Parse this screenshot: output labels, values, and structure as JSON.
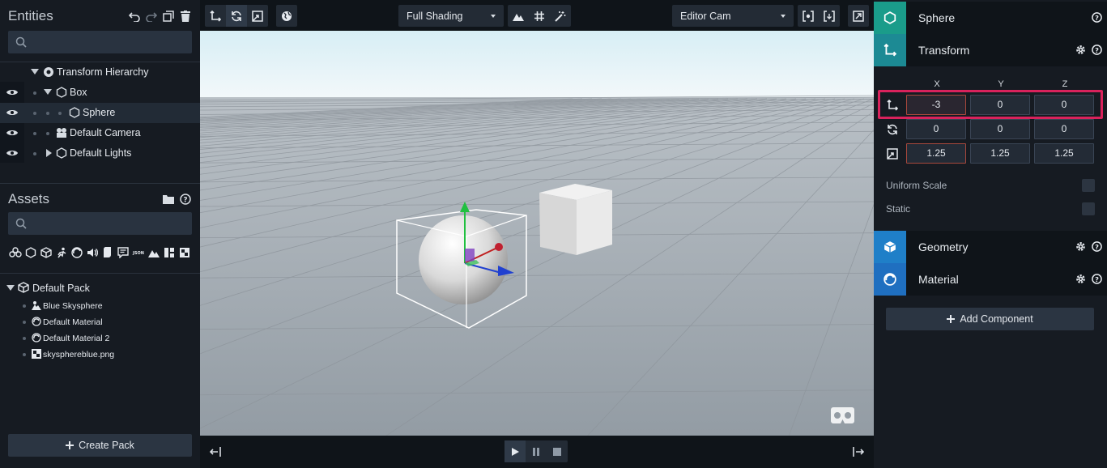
{
  "entities": {
    "title": "Entities",
    "search_placeholder": "",
    "tree": [
      {
        "label": "Transform Hierarchy",
        "icon": "hierarchy-icon"
      },
      {
        "label": "Box",
        "icon": "hexagon-icon"
      },
      {
        "label": "Sphere",
        "icon": "hexagon-icon"
      },
      {
        "label": "Default Camera",
        "icon": "camera-icon"
      },
      {
        "label": "Default Lights",
        "icon": "hexagon-icon"
      }
    ]
  },
  "assets": {
    "title": "Assets",
    "search_placeholder": "",
    "pack": {
      "label": "Default Pack"
    },
    "items": [
      {
        "label": "Blue Skysphere",
        "icon": "skysphere-icon"
      },
      {
        "label": "Default Material",
        "icon": "material-icon"
      },
      {
        "label": "Default Material 2",
        "icon": "material-icon"
      },
      {
        "label": "skysphereblue.png",
        "icon": "texture-icon"
      }
    ],
    "create_pack": "Create Pack"
  },
  "toolbar": {
    "shading": "Full Shading",
    "camera": "Editor Cam"
  },
  "inspector": {
    "entity_name": "Sphere",
    "transform": {
      "title": "Transform",
      "axes": [
        "X",
        "Y",
        "Z"
      ],
      "position": [
        "-3",
        "0",
        "0"
      ],
      "rotation": [
        "0",
        "0",
        "0"
      ],
      "scale": [
        "1.25",
        "1.25",
        "1.25"
      ]
    },
    "uniform_scale_label": "Uniform Scale",
    "static_label": "Static",
    "geometry_title": "Geometry",
    "material_title": "Material",
    "add_component": "Add Component"
  },
  "colors": {
    "entity_accent": "#1a9c8a",
    "transform_accent": "#1c8a94",
    "geometry_accent": "#1f7fc8",
    "material_accent": "#1f6fc0",
    "highlight": "#d9225c"
  }
}
